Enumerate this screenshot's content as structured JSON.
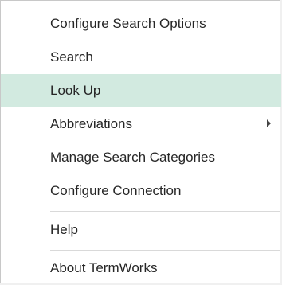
{
  "menu": {
    "items": [
      {
        "label": "Configure Search Options"
      },
      {
        "label": "Search"
      },
      {
        "label": "Look Up"
      },
      {
        "label": "Abbreviations"
      },
      {
        "label": "Manage Search Categories"
      },
      {
        "label": "Configure Connection"
      },
      {
        "label": "Help"
      },
      {
        "label": "About TermWorks"
      }
    ],
    "highlighted_item": "Look Up",
    "highlight_color": "#d2eae0",
    "submenu_icon": "chevron-right-icon"
  }
}
